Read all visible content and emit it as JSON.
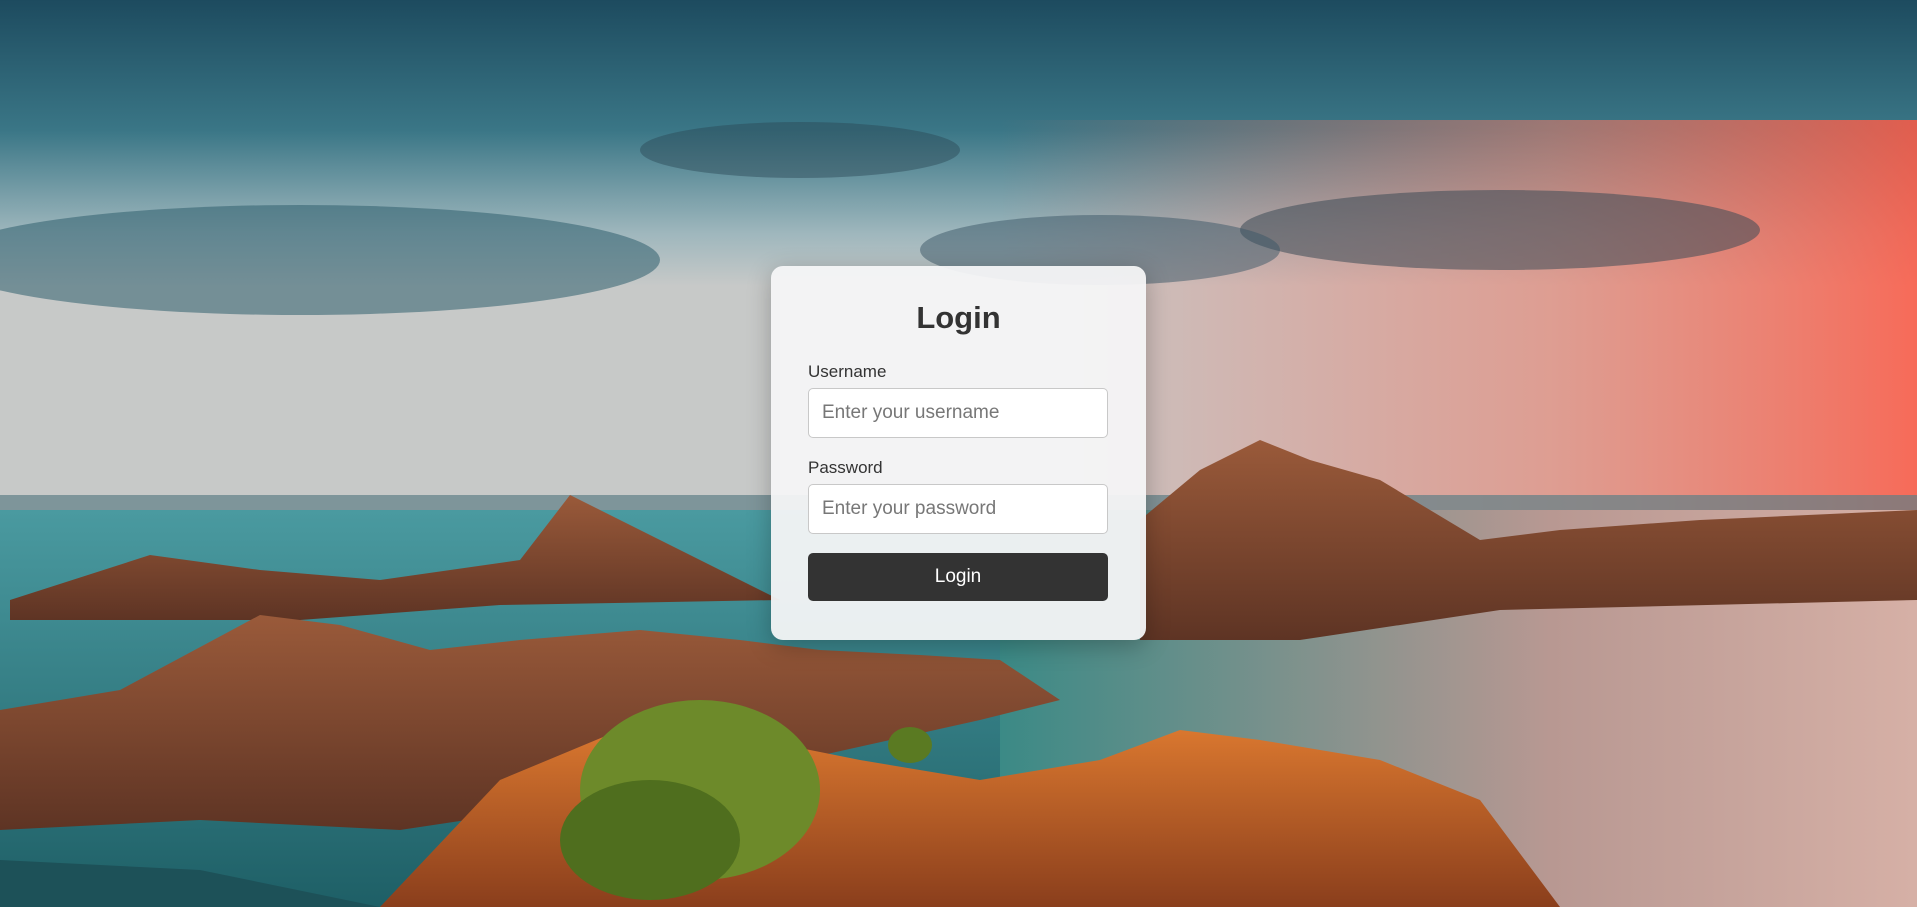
{
  "login": {
    "title": "Login",
    "username_label": "Username",
    "username_placeholder": "Enter your username",
    "username_value": "",
    "password_label": "Password",
    "password_placeholder": "Enter your password",
    "password_value": "",
    "button_label": "Login"
  },
  "colors": {
    "card_background": "#f4f4f5",
    "button_background": "#333333",
    "button_text": "#ffffff",
    "label_text": "#333333"
  }
}
